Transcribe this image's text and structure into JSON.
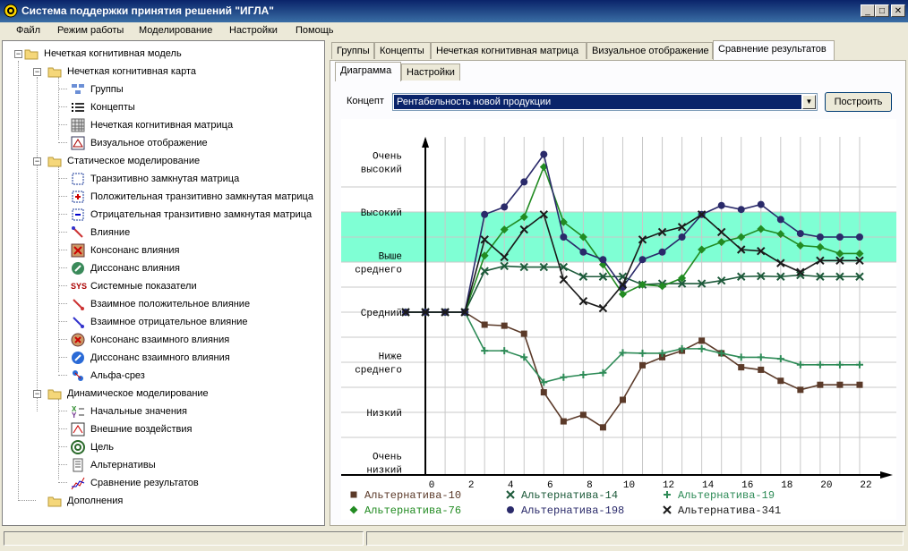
{
  "window": {
    "title": "Система поддержки принятия решений \"ИГЛА\"",
    "btn_min": "_",
    "btn_max": "□",
    "btn_close": "✕"
  },
  "menu": [
    "Файл",
    "Режим работы",
    "Моделирование",
    "Настройки",
    "Помощь"
  ],
  "tree": {
    "root": "Нечеткая когнитивная модель",
    "g1": "Нечеткая когнитивная карта",
    "g1_items": [
      "Группы",
      "Концепты",
      "Нечеткая когнитивная матрица",
      "Визуальное отображение"
    ],
    "g2": "Статическое моделирование",
    "g2_items": [
      "Транзитивно замкнутая матрица",
      "Положительная транзитивно замкнутая матрица",
      "Отрицательная транзитивно замкнутая матрица",
      "Влияние",
      "Консонанс влияния",
      "Диссонанс влияния",
      "Системные показатели",
      "Взаимное положительное влияние",
      "Взаимное отрицательное влияние",
      "Консонанс взаимного влияния",
      "Диссонанс взаимного влияния",
      "Альфа-срез"
    ],
    "g3": "Динамическое моделирование",
    "g3_items": [
      "Начальные значения",
      "Внешние воздействия",
      "Цель",
      "Альтернативы",
      "Сравнение результатов"
    ],
    "g4": "Дополнения",
    "sys_icon_text": "SYS"
  },
  "tabs": [
    "Группы",
    "Концепты",
    "Нечеткая когнитивная матрица",
    "Визуальное отображение",
    "Сравнение результатов"
  ],
  "subtabs": [
    "Диаграмма",
    "Настройки"
  ],
  "concept": {
    "label": "Концепт",
    "value": "Рентабельность новой продукции",
    "arrow": "▼"
  },
  "build_button": "Построить",
  "chart_data": {
    "type": "line",
    "y_levels": [
      [
        "Очень",
        "высокий"
      ],
      [
        "Высокий"
      ],
      [
        "Выше",
        "среднего"
      ],
      [
        "Средний"
      ],
      [
        "Ниже",
        "среднего"
      ],
      [
        "Низкий"
      ],
      [
        "Очень",
        "низкий"
      ]
    ],
    "x_ticks": [
      "0",
      "2",
      "4",
      "6",
      "8",
      "10",
      "12",
      "14",
      "16",
      "18",
      "20",
      "22"
    ],
    "xlim": [
      -1,
      22.5
    ],
    "ylim": [
      -3.25,
      3.5
    ],
    "highlight_band": [
      1,
      2
    ],
    "x": [
      -1,
      0,
      1,
      2,
      3,
      4,
      5,
      6,
      7,
      8,
      9,
      10,
      11,
      12,
      13,
      14,
      15,
      16,
      17,
      18,
      19,
      20,
      21,
      22
    ],
    "series": [
      {
        "name": "Альтернатива-10",
        "color": "#5b3a29",
        "marker": "square",
        "values": [
          0,
          0,
          0,
          0,
          -0.25,
          -0.27,
          -0.43,
          -1.6,
          -2.18,
          -2.05,
          -2.3,
          -1.75,
          -1.06,
          -0.9,
          -0.77,
          -0.57,
          -0.82,
          -1.1,
          -1.15,
          -1.37,
          -1.55,
          -1.45,
          -1.45,
          -1.45
        ]
      },
      {
        "name": "Альтернатива-14",
        "color": "#1d5a3a",
        "marker": "x",
        "values": [
          0,
          0,
          0,
          0,
          0.82,
          0.92,
          0.9,
          0.9,
          0.9,
          0.71,
          0.71,
          0.71,
          0.55,
          0.57,
          0.57,
          0.57,
          0.63,
          0.71,
          0.72,
          0.71,
          0.74,
          0.71,
          0.71,
          0.71
        ]
      },
      {
        "name": "Альтернатива-19",
        "color": "#2e8b57",
        "marker": "plus",
        "values": [
          0,
          0,
          0,
          0,
          -0.77,
          -0.77,
          -0.9,
          -1.4,
          -1.3,
          -1.25,
          -1.21,
          -0.81,
          -0.82,
          -0.82,
          -0.73,
          -0.73,
          -0.82,
          -0.9,
          -0.9,
          -0.93,
          -1.05,
          -1.05,
          -1.05,
          -1.05
        ]
      },
      {
        "name": "Альтернатива-76",
        "color": "#228b22",
        "marker": "diamond",
        "values": [
          0,
          0,
          0,
          0,
          1.13,
          1.65,
          1.9,
          2.9,
          1.8,
          1.5,
          0.95,
          0.36,
          0.55,
          0.52,
          0.68,
          1.25,
          1.4,
          1.5,
          1.66,
          1.56,
          1.33,
          1.3,
          1.17,
          1.17
        ]
      },
      {
        "name": "Альтернатива-198",
        "color": "#2a2a6a",
        "marker": "circle",
        "values": [
          0,
          0,
          0,
          0,
          1.95,
          2.1,
          2.6,
          3.15,
          1.5,
          1.2,
          1.05,
          0.5,
          1.05,
          1.2,
          1.5,
          1.95,
          2.13,
          2.05,
          2.15,
          1.85,
          1.57,
          1.5,
          1.5,
          1.5
        ]
      },
      {
        "name": "Альтернатива-341",
        "color": "#1a1a1a",
        "marker": "x",
        "values": [
          0,
          0,
          0,
          0,
          1.45,
          1.1,
          1.65,
          1.95,
          0.65,
          0.22,
          0.08,
          0.55,
          1.45,
          1.6,
          1.7,
          1.95,
          1.6,
          1.25,
          1.22,
          0.98,
          0.8,
          1.03,
          1.03,
          1.03
        ]
      }
    ]
  }
}
